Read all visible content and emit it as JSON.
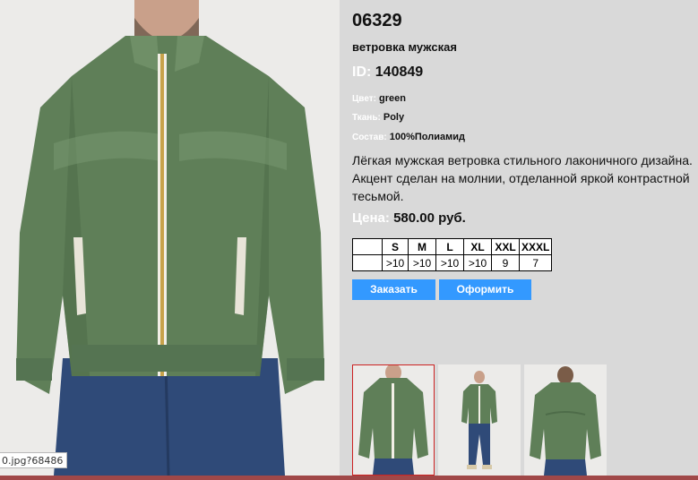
{
  "product": {
    "sku": "06329",
    "subtitle": "ветровка мужская",
    "id_label": "ID:",
    "id_value": "140849",
    "color_label": "Цвет:",
    "color_value": "green",
    "fabric_label": "Ткань:",
    "fabric_value": "Poly",
    "composition_label": "Состав:",
    "composition_value": "100%Полиамид",
    "description_lines": [
      "Лёгкая мужская ветровка стильного лаконичного дизайна.",
      "Акцент сделан на молнии, отделанной яркой контрастной",
      "тесьмой."
    ],
    "price_label": "Цена:",
    "price_value": "580.00 руб."
  },
  "sizes": {
    "headers": [
      "",
      "S",
      "M",
      "L",
      "XL",
      "XXL",
      "XXXL"
    ],
    "stock": [
      "",
      ">10",
      ">10",
      ">10",
      ">10",
      "9",
      "7"
    ]
  },
  "buttons": {
    "order": "Заказать",
    "checkout": "Оформить"
  },
  "status_url": "0.jpg?68486",
  "colors": {
    "jacket_green": "#5f7f58",
    "button_blue": "#3399ff",
    "active_border": "#cc2222",
    "label_white": "#ffffff"
  }
}
